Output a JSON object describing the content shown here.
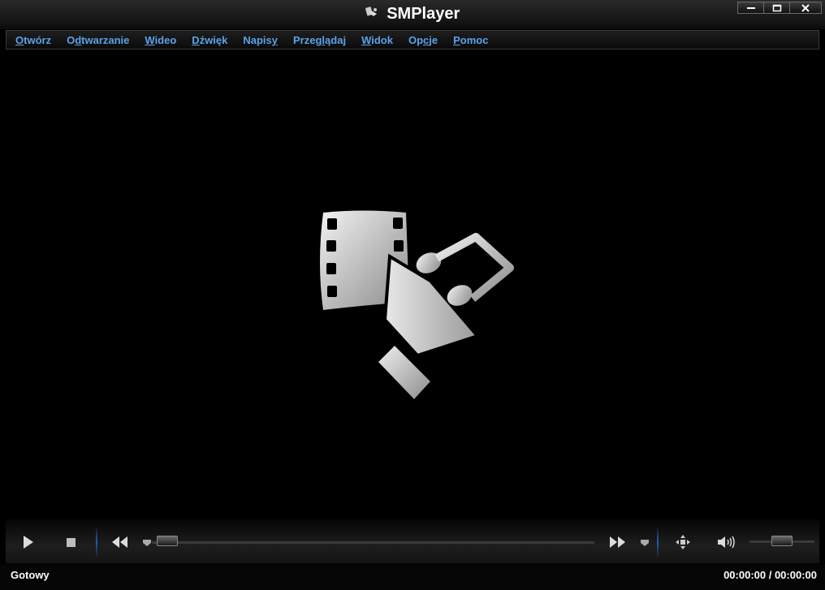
{
  "window": {
    "title": "SMPlayer"
  },
  "menu": [
    {
      "pre": "",
      "u": "O",
      "post": "twórz"
    },
    {
      "pre": "O",
      "u": "d",
      "post": "twarzanie"
    },
    {
      "pre": "",
      "u": "W",
      "post": "ideo"
    },
    {
      "pre": "",
      "u": "D",
      "post": "źwięk"
    },
    {
      "pre": "Napis",
      "u": "y",
      "post": ""
    },
    {
      "pre": "Przeg",
      "u": "l",
      "post": "ądaj"
    },
    {
      "pre": "",
      "u": "W",
      "post": "idok"
    },
    {
      "pre": "Op",
      "u": "c",
      "post": "je"
    },
    {
      "pre": "",
      "u": "P",
      "post": "omoc"
    }
  ],
  "controls": {
    "play": "play-icon",
    "stop": "stop-icon",
    "rewind": "rewind-icon",
    "forward": "forward-icon",
    "fullscreen": "fullscreen-icon",
    "volume": "volume-icon",
    "seek_position": 0,
    "volume_level": 0.5
  },
  "status": {
    "text": "Gotowy",
    "time": "00:00:00 / 00:00:00"
  },
  "colors": {
    "accent": "#5ba3e8",
    "separator": "#1f5fb3"
  }
}
